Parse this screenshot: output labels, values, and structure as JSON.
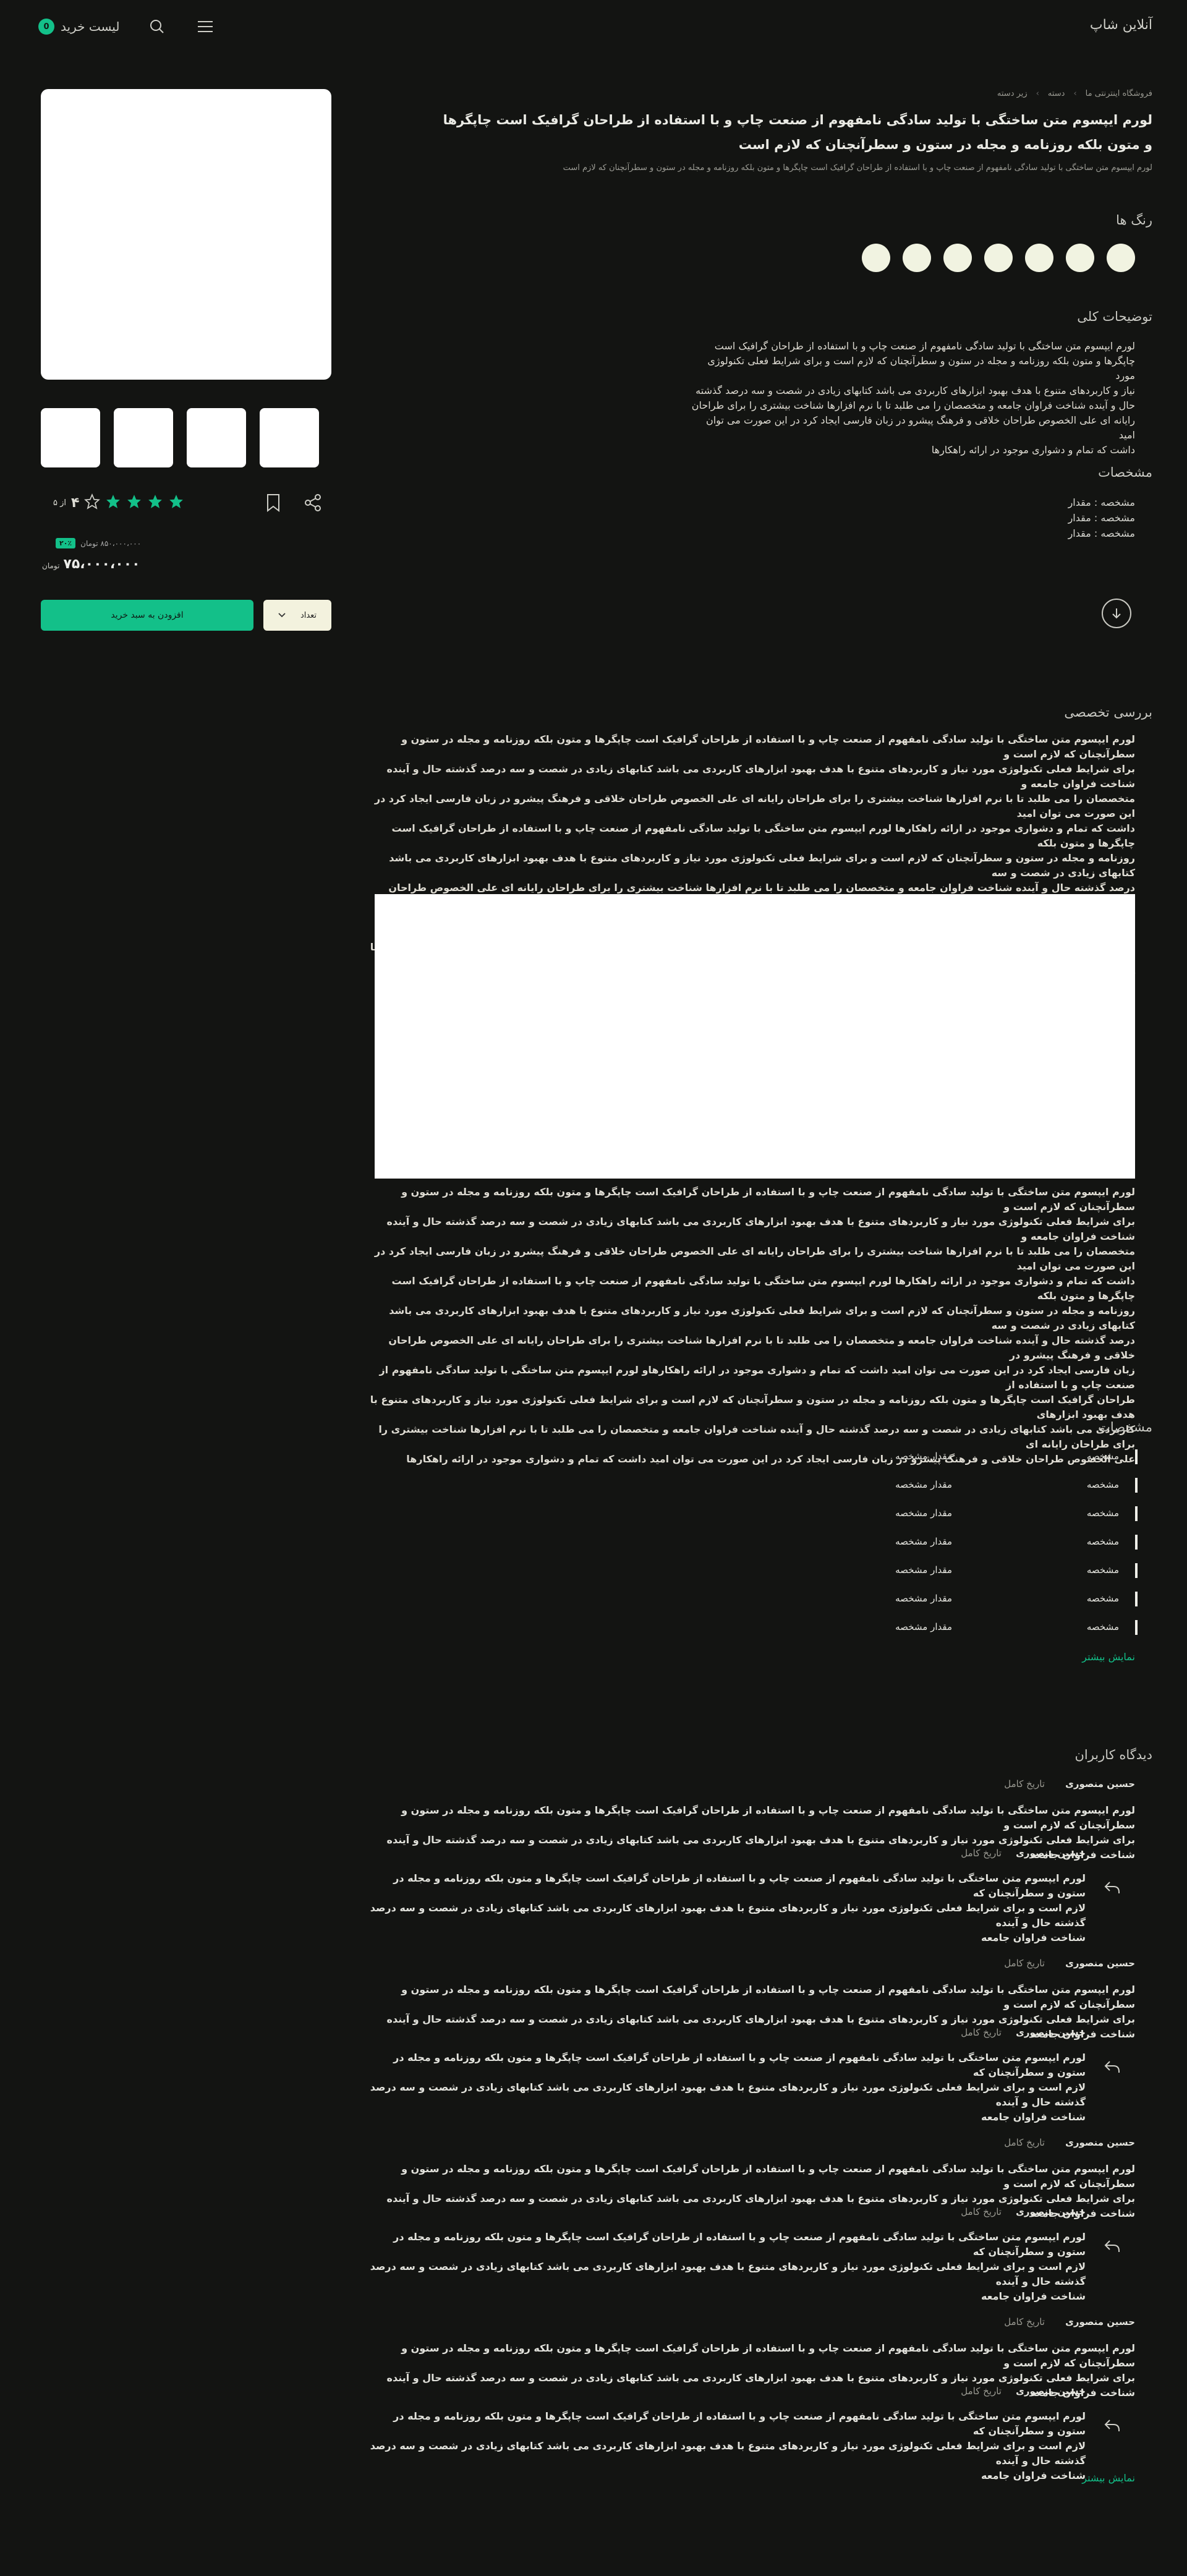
{
  "header": {
    "brand": "آنلاین شاپ",
    "cart_label": "لیست خرید",
    "cart_count": "0",
    "icons": [
      "menu-icon",
      "search-icon"
    ]
  },
  "breadcrumb": [
    "فروشگاه اینترنتی ما",
    "دسته",
    "زیر دسته"
  ],
  "product": {
    "title": "لورم ایپسوم متن ساختگی با تولید سادگی نامفهوم از صنعت چاپ و با استفاده از طراحان گرافیک است چاپگرها و متون بلکه روزنامه و مجله در ستون و سطرآنچنان که لازم است",
    "subtitle": "لورم ایپسوم متن ساختگی با تولید سادگی نامفهوم از صنعت چاپ و با استفاده از طراحان گرافیک است چاپگرها و متون بلکه روزنامه و مجله در ستون و سطرآنچنان که لازم است",
    "colors_title": "رنگ ها",
    "swatch_count": 7,
    "swatch_color": "#f1f3e1",
    "desc_title": "توضیحات کلی",
    "desc_lines": [
      "لورم ایپسوم متن ساختگی با تولید سادگی نامفهوم از صنعت چاپ و با استفاده از طراحان گرافیک است",
      "چاپگرها و متون بلکه روزنامه و مجله در ستون و سطرآنچنان که لازم است و برای شرایط فعلی تکنولوژی مورد",
      "نیاز و کاربردهای متنوع با هدف بهبود ابزارهای کاربردی می باشد کتابهای زیادی در شصت و سه درصد گذشته",
      "حال و آینده شناخت فراوان جامعه و متخصصان را می طلبد تا با نرم افزارها شناخت بیشتری را برای طراحان",
      "رایانه ای علی الخصوص طراحان خلاقی و فرهنگ پیشرو در زبان فارسی ایجاد کرد در این صورت می توان امید",
      "داشت که تمام و دشواری موجود در ارائه راهکارها"
    ],
    "specs_title": "مشخصات",
    "specs_mini": [
      "مشخصه : مقدار",
      "مشخصه : مقدار",
      "مشخصه : مقدار"
    ]
  },
  "purchase": {
    "rating": "۴",
    "rating_label": "از ۵",
    "stars_filled": 4,
    "stars_total": 5,
    "discount": "۲۰٪",
    "old_price": "۸۵۰،۰۰۰،۰۰۰ تومان",
    "price": "۷۵،۰۰۰،۰۰۰",
    "currency": "تومان",
    "add_to_cart": "افزودن به سبد خرید",
    "qty_label": "تعداد"
  },
  "review": {
    "title": "بررسی تخصصی",
    "para1": [
      "لورم ایپسوم متن ساختگی با تولید سادگی نامفهوم از صنعت چاپ و با استفاده از طراحان گرافیک است چاپگرها و متون بلکه روزنامه و مجله در ستون و سطرآنچنان که لازم است و",
      "برای شرایط فعلی تکنولوژی مورد نیاز و کاربردهای متنوع با هدف بهبود ابزارهای کاربردی می باشد کتابهای زیادی در شصت و سه درصد گذشته حال و آینده شناخت فراوان جامعه و",
      "متخصصان را می طلبد تا با نرم افزارها شناخت بیشتری را برای طراحان رایانه ای علی الخصوص طراحان خلاقی و فرهنگ پیشرو در زبان فارسی ایجاد کرد در این صورت می توان امید",
      "داشت که تمام و دشواری موجود در ارائه راهکارها لورم ایپسوم متن ساختگی با تولید سادگی نامفهوم از صنعت چاپ و با استفاده از طراحان گرافیک است چاپگرها و متون بلکه",
      "روزنامه و مجله در ستون و سطرآنچنان که لازم است و برای شرایط فعلی تکنولوژی مورد نیاز و کاربردهای متنوع با هدف بهبود ابزارهای کاربردی می باشد کتابهای زیادی در شصت و سه",
      "درصد گذشته حال و آینده شناخت فراوان جامعه و متخصصان را می طلبد تا با نرم افزارها شناخت بیشتری را برای طراحان رایانه ای علی الخصوص طراحان خلاقی و فرهنگ پیشرو در",
      "زبان فارسی ایجاد کرد در این صورت می توان امید داشت که تمام و دشواری موجود در ارائه راهکارهاو لورم ایپسوم متن ساختگی با تولید سادگی نامفهوم از صنعت چاپ و با استفاده از",
      "طراحان گرافیک است چاپگرها و متون بلکه روزنامه و مجله در ستون و سطرآنچنان که لازم است و برای شرایط فعلی تکنولوژی مورد نیاز و کاربردهای متنوع با هدف بهبود ابزارهای",
      "کاربردی می باشد کتابهای زیادی در شصت و سه درصد گذشته حال و آینده شناخت فراوان جامعه و متخصصان را می طلبد تا با نرم افزارها شناخت بیشتری را برای طراحان رایانه ای",
      "علی الخصوص طراحان خلاقی و فرهنگ پیشرو در زبان فارسی ایجاد کرد در این صورت می توان امید داشت که تمام و دشواری موجود در ارائه راهکارها"
    ],
    "para2": [
      "لورم ایپسوم متن ساختگی با تولید سادگی نامفهوم از صنعت چاپ و با استفاده از طراحان گرافیک است چاپگرها و متون بلکه روزنامه و مجله در ستون و سطرآنچنان که لازم است و",
      "برای شرایط فعلی تکنولوژی مورد نیاز و کاربردهای متنوع با هدف بهبود ابزارهای کاربردی می باشد کتابهای زیادی در شصت و سه درصد گذشته حال و آینده شناخت فراوان جامعه و",
      "متخصصان را می طلبد تا با نرم افزارها شناخت بیشتری را برای طراحان رایانه ای علی الخصوص طراحان خلاقی و فرهنگ پیشرو در زبان فارسی ایجاد کرد در این صورت می توان امید",
      "داشت که تمام و دشواری موجود در ارائه راهکارها لورم ایپسوم متن ساختگی با تولید سادگی نامفهوم از صنعت چاپ و با استفاده از طراحان گرافیک است چاپگرها و متون بلکه",
      "روزنامه و مجله در ستون و سطرآنچنان که لازم است و برای شرایط فعلی تکنولوژی مورد نیاز و کاربردهای متنوع با هدف بهبود ابزارهای کاربردی می باشد کتابهای زیادی در شصت و سه",
      "درصد گذشته حال و آینده شناخت فراوان جامعه و متخصصان را می طلبد تا با نرم افزارها شناخت بیشتری را برای طراحان رایانه ای علی الخصوص طراحان خلاقی و فرهنگ پیشرو در",
      "زبان فارسی ایجاد کرد در این صورت می توان امید داشت که تمام و دشواری موجود در ارائه راهکارهاو لورم ایپسوم متن ساختگی با تولید سادگی نامفهوم از صنعت چاپ و با استفاده از",
      "طراحان گرافیک است چاپگرها و متون بلکه روزنامه و مجله در ستون و سطرآنچنان که لازم است و برای شرایط فعلی تکنولوژی مورد نیاز و کاربردهای متنوع با هدف بهبود ابزارهای",
      "کاربردی می باشد کتابهای زیادی در شصت و سه درصد گذشته حال و آینده شناخت فراوان جامعه و متخصصان را می طلبد تا با نرم افزارها شناخت بیشتری را برای طراحان رایانه ای",
      "علی الخصوص طراحان خلاقی و فرهنگ پیشرو در زبان فارسی ایجاد کرد در این صورت می توان امید داشت که تمام و دشواری موجود در ارائه راهکارها"
    ]
  },
  "specs": {
    "title": "مشخصات",
    "rows": [
      {
        "key": "مشخصه",
        "value": "مقدار مشخصه"
      },
      {
        "key": "مشخصه",
        "value": "مقدار مشخصه"
      },
      {
        "key": "مشخصه",
        "value": "مقدار مشخصه"
      },
      {
        "key": "مشخصه",
        "value": "مقدار مشخصه"
      },
      {
        "key": "مشخصه",
        "value": "مقدار مشخصه"
      },
      {
        "key": "مشخصه",
        "value": "مقدار مشخصه"
      },
      {
        "key": "مشخصه",
        "value": "مقدار مشخصه"
      }
    ],
    "more": "نمایش بیشتر"
  },
  "comments": {
    "title": "دیدگاه کاربران",
    "more": "نمایش بیشتر",
    "items": [
      {
        "name": "حسین منصوری",
        "date": "تاریخ کامل",
        "text": [
          "لورم ایپسوم متن ساختگی با تولید سادگی نامفهوم از صنعت چاپ و با استفاده از طراحان گرافیک است چاپگرها و متون بلکه روزنامه و مجله در ستون و سطرآنچنان که لازم است و",
          "برای شرایط فعلی تکنولوژی مورد نیاز و کاربردهای متنوع با هدف بهبود ابزارهای کاربردی می باشد کتابهای زیادی در شصت و سه درصد گذشته حال و آینده شناخت فراوان جامعه"
        ],
        "reply": {
          "name": "حسین منصوری",
          "date": "تاریخ کامل",
          "text": [
            "لورم ایپسوم متن ساختگی با تولید سادگی نامفهوم از صنعت چاپ و با استفاده از طراحان گرافیک است چاپگرها و متون بلکه روزنامه و مجله در ستون و سطرآنچنان که",
            "لازم است و برای شرایط فعلی تکنولوژی مورد نیاز و کاربردهای متنوع با هدف بهبود ابزارهای کاربردی می باشد کتابهای زیادی در شصت و سه درصد گذشته حال و آینده",
            "شناخت فراوان جامعه"
          ]
        }
      },
      {
        "name": "حسین منصوری",
        "date": "تاریخ کامل",
        "text": [
          "لورم ایپسوم متن ساختگی با تولید سادگی نامفهوم از صنعت چاپ و با استفاده از طراحان گرافیک است چاپگرها و متون بلکه روزنامه و مجله در ستون و سطرآنچنان که لازم است و",
          "برای شرایط فعلی تکنولوژی مورد نیاز و کاربردهای متنوع با هدف بهبود ابزارهای کاربردی می باشد کتابهای زیادی در شصت و سه درصد گذشته حال و آینده شناخت فراوان جامعه"
        ],
        "reply": {
          "name": "حسین منصوری",
          "date": "تاریخ کامل",
          "text": [
            "لورم ایپسوم متن ساختگی با تولید سادگی نامفهوم از صنعت چاپ و با استفاده از طراحان گرافیک است چاپگرها و متون بلکه روزنامه و مجله در ستون و سطرآنچنان که",
            "لازم است و برای شرایط فعلی تکنولوژی مورد نیاز و کاربردهای متنوع با هدف بهبود ابزارهای کاربردی می باشد کتابهای زیادی در شصت و سه درصد گذشته حال و آینده",
            "شناخت فراوان جامعه"
          ]
        }
      },
      {
        "name": "حسین منصوری",
        "date": "تاریخ کامل",
        "text": [
          "لورم ایپسوم متن ساختگی با تولید سادگی نامفهوم از صنعت چاپ و با استفاده از طراحان گرافیک است چاپگرها و متون بلکه روزنامه و مجله در ستون و سطرآنچنان که لازم است و",
          "برای شرایط فعلی تکنولوژی مورد نیاز و کاربردهای متنوع با هدف بهبود ابزارهای کاربردی می باشد کتابهای زیادی در شصت و سه درصد گذشته حال و آینده شناخت فراوان جامعه"
        ],
        "reply": {
          "name": "حسین منصوری",
          "date": "تاریخ کامل",
          "text": [
            "لورم ایپسوم متن ساختگی با تولید سادگی نامفهوم از صنعت چاپ و با استفاده از طراحان گرافیک است چاپگرها و متون بلکه روزنامه و مجله در ستون و سطرآنچنان که",
            "لازم است و برای شرایط فعلی تکنولوژی مورد نیاز و کاربردهای متنوع با هدف بهبود ابزارهای کاربردی می باشد کتابهای زیادی در شصت و سه درصد گذشته حال و آینده",
            "شناخت فراوان جامعه"
          ]
        }
      },
      {
        "name": "حسین منصوری",
        "date": "تاریخ کامل",
        "text": [
          "لورم ایپسوم متن ساختگی با تولید سادگی نامفهوم از صنعت چاپ و با استفاده از طراحان گرافیک است چاپگرها و متون بلکه روزنامه و مجله در ستون و سطرآنچنان که لازم است و",
          "برای شرایط فعلی تکنولوژی مورد نیاز و کاربردهای متنوع با هدف بهبود ابزارهای کاربردی می باشد کتابهای زیادی در شصت و سه درصد گذشته حال و آینده شناخت فراوان جامعه"
        ],
        "reply": {
          "name": "حسین منصوری",
          "date": "تاریخ کامل",
          "text": [
            "لورم ایپسوم متن ساختگی با تولید سادگی نامفهوم از صنعت چاپ و با استفاده از طراحان گرافیک است چاپگرها و متون بلکه روزنامه و مجله در ستون و سطرآنچنان که",
            "لازم است و برای شرایط فعلی تکنولوژی مورد نیاز و کاربردهای متنوع با هدف بهبود ابزارهای کاربردی می باشد کتابهای زیادی در شصت و سه درصد گذشته حال و آینده",
            "شناخت فراوان جامعه"
          ]
        }
      }
    ]
  },
  "colors": {
    "accent": "#13c089",
    "background": "#131412",
    "swatch": "#f1f3e1"
  }
}
